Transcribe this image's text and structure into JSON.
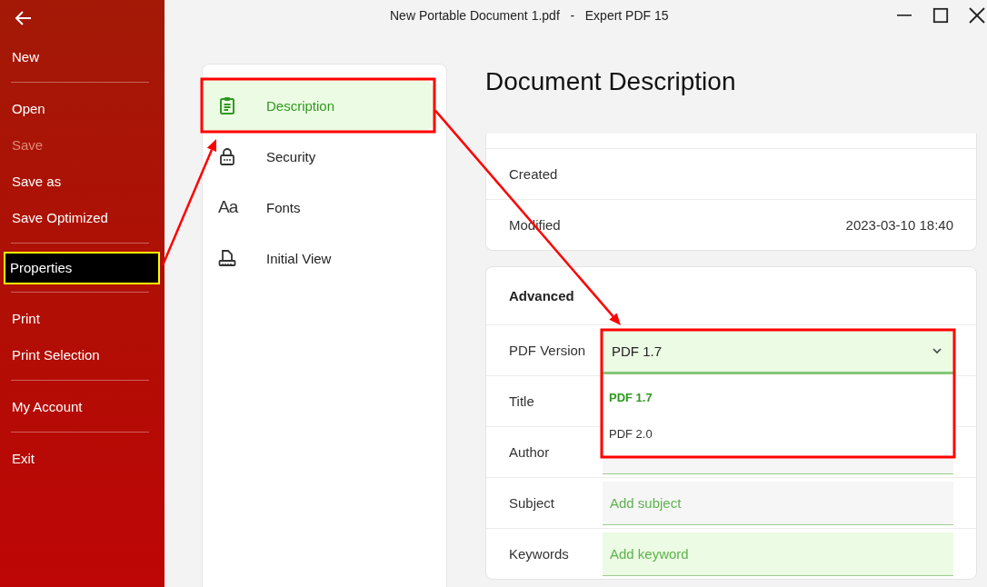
{
  "window": {
    "title": "New Portable Document 1.pdf   -   Expert PDF 15"
  },
  "sidebar": {
    "items": [
      {
        "kind": "item",
        "label": "New",
        "disabled": false,
        "selected": false
      },
      {
        "kind": "separator"
      },
      {
        "kind": "item",
        "label": "Open",
        "disabled": false,
        "selected": false
      },
      {
        "kind": "item",
        "label": "Save",
        "disabled": true,
        "selected": false
      },
      {
        "kind": "item",
        "label": "Save as",
        "disabled": false,
        "selected": false
      },
      {
        "kind": "item",
        "label": "Save Optimized",
        "disabled": false,
        "selected": false
      },
      {
        "kind": "separator"
      },
      {
        "kind": "item",
        "label": "Properties",
        "disabled": false,
        "selected": true,
        "annotated": true
      },
      {
        "kind": "separator"
      },
      {
        "kind": "item",
        "label": "Print",
        "disabled": false,
        "selected": false
      },
      {
        "kind": "item",
        "label": "Print Selection",
        "disabled": false,
        "selected": false
      },
      {
        "kind": "separator"
      },
      {
        "kind": "item",
        "label": "My Account",
        "disabled": false,
        "selected": false
      },
      {
        "kind": "separator"
      },
      {
        "kind": "item",
        "label": "Exit",
        "disabled": false,
        "selected": false
      }
    ]
  },
  "nav": {
    "items": [
      {
        "label": "Description",
        "kind": "clipboard",
        "selected": true,
        "annotated": true
      },
      {
        "label": "Security",
        "kind": "lock",
        "selected": false
      },
      {
        "label": "Fonts",
        "kind": "glyph",
        "glyph": "Aa",
        "selected": false
      },
      {
        "label": "Initial View",
        "kind": "ruler",
        "selected": false
      }
    ]
  },
  "heading": "Document Description",
  "dates": [
    {
      "label": "Created"
    },
    {
      "label": "Modified",
      "value": "2023-03-10 18:40"
    }
  ],
  "advanced": {
    "title": "Advanced",
    "rows": [
      {
        "kind": "select",
        "label": "PDF Version",
        "value": "PDF 1.7",
        "expanded": true,
        "annotated": true,
        "options": [
          {
            "label": "PDF 1.7",
            "selected": true
          },
          {
            "label": "PDF 2.0",
            "selected": false
          }
        ]
      },
      {
        "kind": "plain",
        "label": "Title"
      },
      {
        "kind": "text",
        "label": "Author"
      },
      {
        "kind": "text",
        "label": "Subject",
        "placeholder": "Add subject",
        "focused": false
      },
      {
        "kind": "text",
        "label": "Keywords",
        "placeholder": "Add keyword",
        "focused": true
      }
    ]
  },
  "annotations": {
    "color": "#ff0000"
  }
}
